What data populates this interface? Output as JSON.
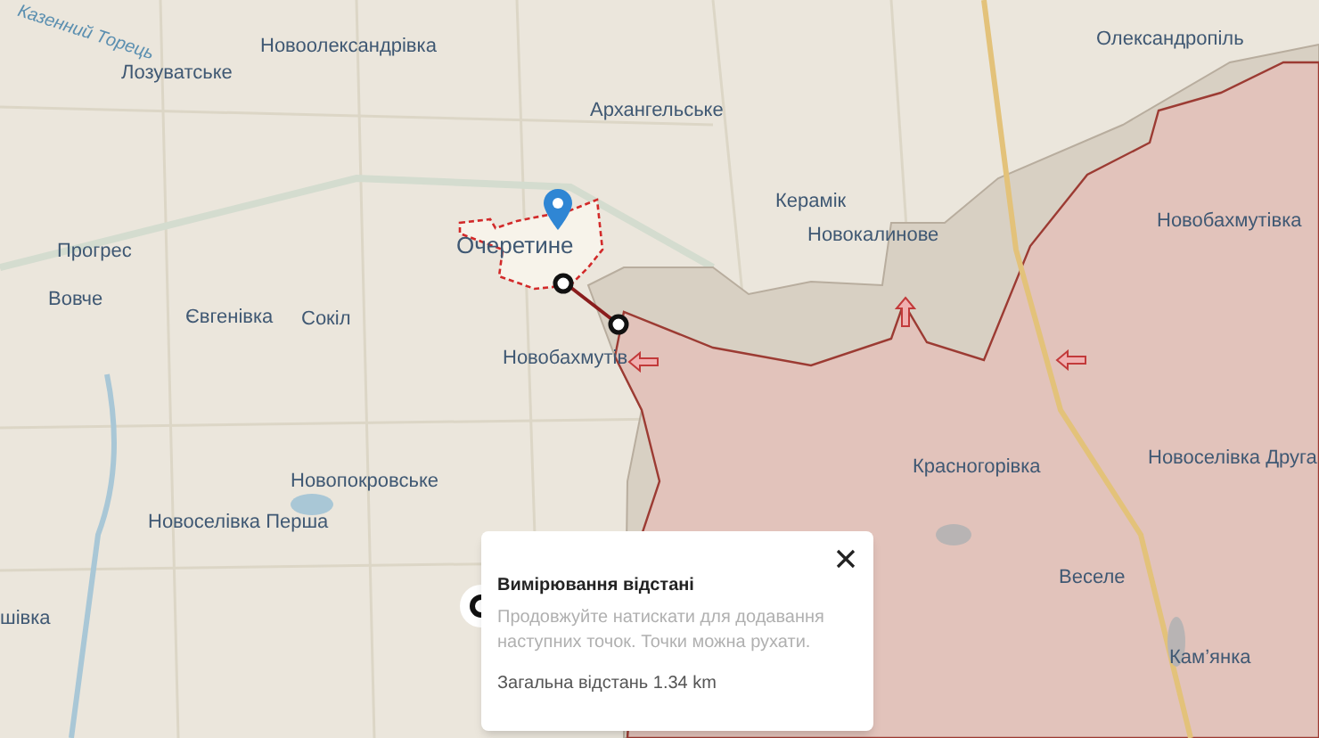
{
  "map": {
    "labels": [
      {
        "text": "Казенний Торець",
        "kind": "river"
      },
      {
        "text": "Новоолександрівка",
        "kind": "place"
      },
      {
        "text": "Олександропіль",
        "kind": "place"
      },
      {
        "text": "Лозуватське",
        "kind": "place"
      },
      {
        "text": "Архангельське",
        "kind": "place"
      },
      {
        "text": "Керамік",
        "kind": "place"
      },
      {
        "text": "Новобахмутівка",
        "kind": "place"
      },
      {
        "text": "Прогрес",
        "kind": "place"
      },
      {
        "text": "Очеретине",
        "kind": "major"
      },
      {
        "text": "Новокалинове",
        "kind": "place"
      },
      {
        "text": "Вовче",
        "kind": "place"
      },
      {
        "text": "Євгенівка",
        "kind": "place"
      },
      {
        "text": "Сокіл",
        "kind": "place"
      },
      {
        "text": "Новобахмутів",
        "kind": "place"
      },
      {
        "text": "Красногорівка",
        "kind": "place"
      },
      {
        "text": "Новоселівка Друга",
        "kind": "place"
      },
      {
        "text": "Новопокровське",
        "kind": "place"
      },
      {
        "text": "Новоселівка Перша",
        "kind": "place"
      },
      {
        "text": "Веселе",
        "kind": "place"
      },
      {
        "text": "шівка",
        "kind": "place"
      },
      {
        "text": "Кам’янка",
        "kind": "place"
      }
    ]
  },
  "popup": {
    "title": "Вимірювання відстані",
    "hint": "Продовжуйте натискати для додавання наступних точок. Точки можна рухати.",
    "total": "Загальна відстань 1.34 km"
  }
}
